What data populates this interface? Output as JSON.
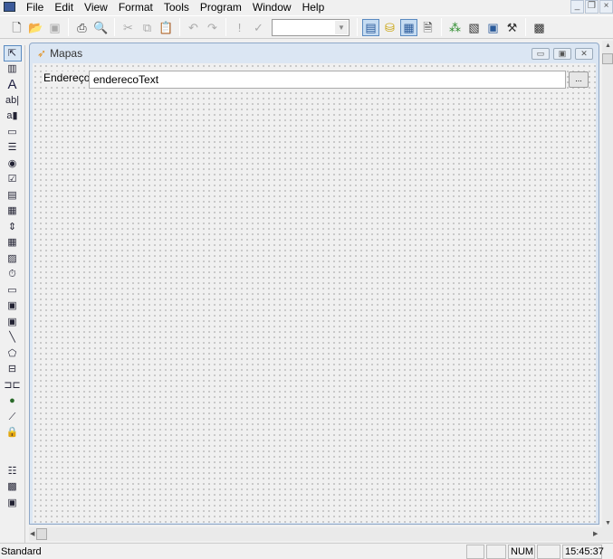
{
  "menubar": {
    "items": [
      "File",
      "Edit",
      "View",
      "Format",
      "Tools",
      "Program",
      "Window",
      "Help"
    ]
  },
  "window_controls": {
    "minimize": "_",
    "restore": "❐",
    "close": "×"
  },
  "toolbar": {
    "combo_value": ""
  },
  "form": {
    "title": "Mapas",
    "label": "Endereço",
    "textbox_value": "enderecoText",
    "button_label": "..."
  },
  "status": {
    "text": "Standard",
    "pane1": "",
    "num": "NUM",
    "pane3": "",
    "time": "15:45:37"
  }
}
